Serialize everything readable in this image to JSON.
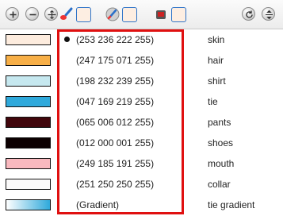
{
  "toolbar": {
    "buttons": [
      {
        "icon": "add-icon"
      },
      {
        "icon": "remove-icon"
      },
      {
        "icon": "move-icon"
      },
      {
        "icon": "brush-icon"
      },
      {
        "icon": "color-swatch-icon",
        "color": "#fdeee2"
      },
      {
        "icon": "pencil-icon"
      },
      {
        "icon": "color-swatch-icon",
        "color": "#fdeee2"
      },
      {
        "icon": "paint-bucket-icon"
      },
      {
        "icon": "color-swatch-icon",
        "color": "#fdeee2"
      },
      {
        "icon": "refresh-icon"
      },
      {
        "icon": "split-icon"
      }
    ]
  },
  "colors": [
    {
      "value": "(253 236 222 255)",
      "name": "skin",
      "swatch": "#fdecde",
      "selected": true
    },
    {
      "value": "(247 175 071 255)",
      "name": "hair",
      "swatch": "#f7af47",
      "selected": false
    },
    {
      "value": "(198 232 239 255)",
      "name": "shirt",
      "swatch": "#c6e8ef",
      "selected": false
    },
    {
      "value": "(047 169 219 255)",
      "name": "tie",
      "swatch": "#2fa9db",
      "selected": false
    },
    {
      "value": "(065 006 012 255)",
      "name": "pants",
      "swatch": "#41060c",
      "selected": false
    },
    {
      "value": "(012 000 001 255)",
      "name": "shoes",
      "swatch": "#0c0001",
      "selected": false
    },
    {
      "value": "(249 185 191 255)",
      "name": "mouth",
      "swatch": "#f9b9bf",
      "selected": false
    },
    {
      "value": "(251 250 250 255)",
      "name": "collar",
      "swatch": "#fbfafa",
      "selected": false
    },
    {
      "value": "(Gradient)",
      "name": "tie gradient",
      "swatch": "gradient",
      "gradient_colors": [
        "#ffffff",
        "#2fa9db"
      ],
      "selected": false
    }
  ],
  "highlight_color": "#e01010"
}
